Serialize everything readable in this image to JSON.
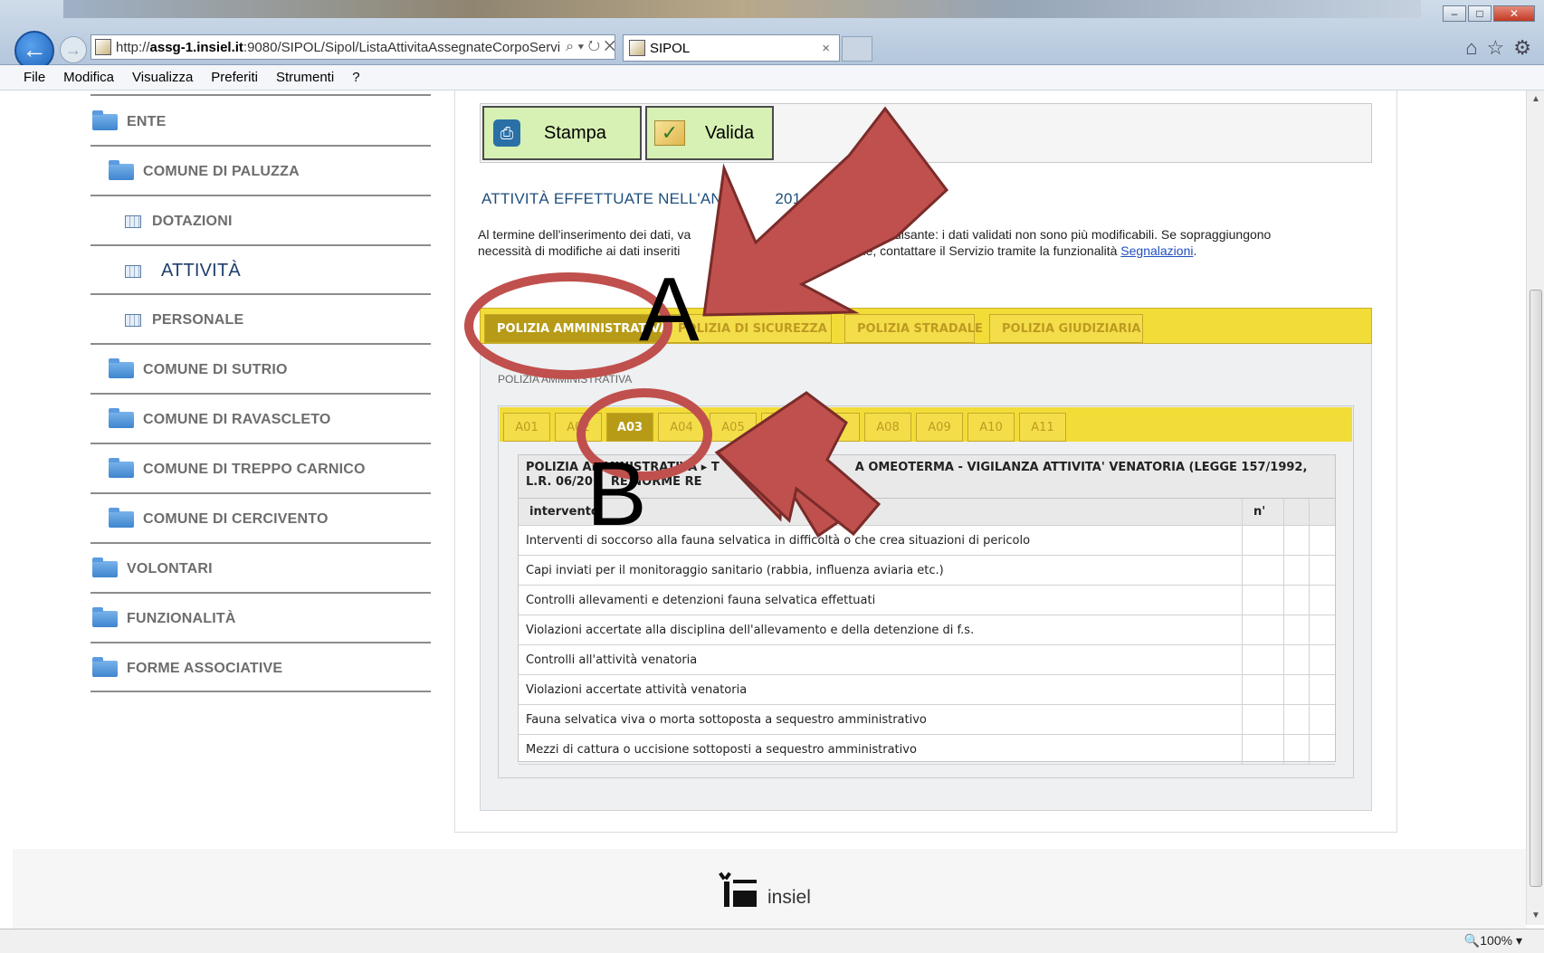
{
  "browser": {
    "url_prefix": "http://",
    "url_host": "assg-1.insiel.it",
    "url_path": ":9080/SIPOL/Sipol/ListaAttivitaAssegnateCorpoServi",
    "url_controls": "⌕ ▾ ↻ ✕",
    "tab_title": "SIPOL",
    "tab_close": "×",
    "menu": [
      "File",
      "Modifica",
      "Visualizza",
      "Preferiti",
      "Strumenti",
      "?"
    ],
    "zoom": "100%"
  },
  "sidebar": {
    "items": [
      {
        "label": "ENTE",
        "icon": "folder-icon"
      },
      {
        "label": "COMUNE DI PALUZZA",
        "icon": "folder-icon"
      },
      {
        "label": "DOTAZIONI",
        "icon": "grid-icon"
      },
      {
        "label": "ATTIVITÀ",
        "icon": "grid-icon"
      },
      {
        "label": "PERSONALE",
        "icon": "grid-icon"
      },
      {
        "label": "COMUNE DI SUTRIO",
        "icon": "folder-icon"
      },
      {
        "label": "COMUNE DI RAVASCLETO",
        "icon": "folder-icon"
      },
      {
        "label": "COMUNE DI TREPPO CARNICO",
        "icon": "folder-icon"
      },
      {
        "label": "COMUNE DI CERCIVENTO",
        "icon": "folder-icon"
      },
      {
        "label": "VOLONTARI",
        "icon": "folder-icon"
      },
      {
        "label": "FUNZIONALITÀ",
        "icon": "folder-icon"
      },
      {
        "label": "FORME ASSOCIATIVE",
        "icon": "folder-icon"
      }
    ]
  },
  "toolbar": {
    "print_label": "Stampa",
    "validate_label": "Valida"
  },
  "main": {
    "title": "ATTIVITÀ EFFETTUATE NELL'ANN",
    "title_tail": "201",
    "intro_text_a": "Al termine dell'inserimento dei dati, va",
    "intro_text_b": "apposito pulsante: i dati validati non sono più modificabili. Se sopraggiungono",
    "intro_text_c": "necessità di modifiche ai dati inseriti",
    "intro_text_d": "alidazione, contattare il Servizio tramite la funzionalità",
    "intro_link": "Segnalazioni",
    "tabs": [
      "POLIZIA AMMINISTRATIVA",
      "POLIZIA DI SICUREZZA",
      "POLIZIA STRADALE",
      "POLIZIA GIUDIZIARIA"
    ],
    "subsection_label": "POLIZIA AMMINISTRATIVA",
    "subtabs": [
      "A01",
      "A02",
      "A03",
      "A04",
      "A05",
      "A06",
      "A07",
      "A08",
      "A09",
      "A10",
      "A11"
    ],
    "active_subtab": "A03",
    "table_title_a": "POLIZIA AMMINISTRATIVA",
    "table_title_b": "T",
    "table_title_c": "A OMEOTERMA - VIGILANZA ATTIVITA' VENATORIA (LEGGE 157/1992,",
    "table_title_d": "L.R. 06/20",
    "table_title_e": "RE NORME RE",
    "col_intervento": "intervento",
    "col_n": "n'",
    "rows": [
      "Interventi di soccorso alla fauna selvatica in difficoltà o che crea situazioni di pericolo",
      "Capi inviati per il monitoraggio sanitario (rabbia, influenza aviaria etc.)",
      "Controlli allevamenti e detenzioni fauna selvatica effettuati",
      "Violazioni accertate alla disciplina dell'allevamento e della detenzione di f.s.",
      "Controlli all'attività venatoria",
      "Violazioni accertate attività venatoria",
      "Fauna selvatica viva o morta sottoposta a sequestro amministrativo",
      "Mezzi di cattura o uccisione sottoposti a sequestro amministrativo"
    ]
  },
  "footer": {
    "logo_text": "insiel"
  },
  "annotations": {
    "label_a": "A",
    "label_b": "B",
    "arrow_color": "#c0504d",
    "ellipse_color": "#c0504d"
  },
  "colors": {
    "tab_yellow": "#f2dc37",
    "tab_active": "#b79b16",
    "button_green": "#d7f0b3",
    "title_blue": "#1f4f7e"
  }
}
